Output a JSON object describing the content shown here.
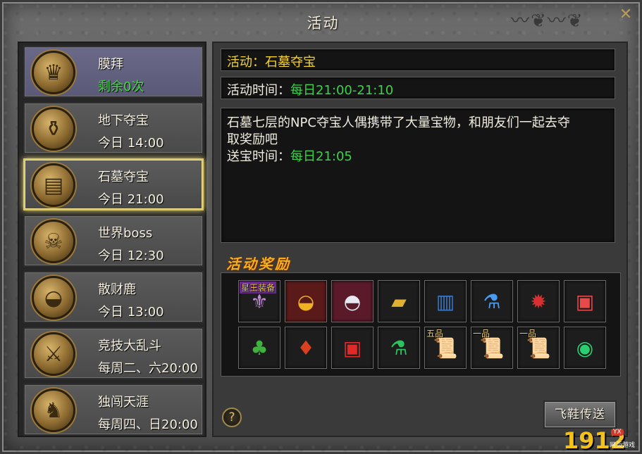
{
  "window": {
    "title": "活动"
  },
  "activities": [
    {
      "name": "膜拜",
      "time": "剩余0次",
      "icon": "statue-icon",
      "glyph": "♛"
    },
    {
      "name": "地下夺宝",
      "time": "今日 14:00",
      "icon": "treasure-pile-icon",
      "glyph": "⚱"
    },
    {
      "name": "石墓夺宝",
      "time": "今日 21:00",
      "icon": "treasure-chest-icon",
      "glyph": "▤"
    },
    {
      "name": "世界boss",
      "time": "今日 12:30",
      "icon": "demon-boss-icon",
      "glyph": "☠"
    },
    {
      "name": "散财鹿",
      "time": "今日 13:00",
      "icon": "gold-ingot-icon",
      "glyph": "◒"
    },
    {
      "name": "竞技大乱斗",
      "time": "每周二、六20:00",
      "icon": "crossed-swords-icon",
      "glyph": "⚔"
    },
    {
      "name": "独闯天涯",
      "time": "每周四、日20:00",
      "icon": "warrior-icon",
      "glyph": "♞"
    }
  ],
  "detail": {
    "activity_label": "活动：石墓夺宝",
    "time_label": "活动时间：",
    "time_value": "每日21:00-21:10",
    "description_line1": "石墓七层的NPC夺宝人偶携带了大量宝物，和朋友们一起去夺",
    "description_line2": "取奖励吧",
    "delivery_label": "送宝时间：",
    "delivery_value": "每日21:05"
  },
  "rewards": {
    "title": "活动奖励",
    "row1": [
      {
        "icon": "star-king-equipment-icon",
        "glyph": "⚜",
        "badge": "星王装备"
      },
      {
        "icon": "gold-ingot-red-icon",
        "glyph": "◒",
        "badge": ""
      },
      {
        "icon": "silver-ingot-icon",
        "glyph": "◓",
        "badge": ""
      },
      {
        "icon": "gold-bar-icon",
        "glyph": "▰",
        "badge": ""
      },
      {
        "icon": "skill-book-icon",
        "glyph": "▥",
        "badge": ""
      },
      {
        "icon": "blue-potion-icon",
        "glyph": "⚗",
        "badge": ""
      },
      {
        "icon": "red-gem-icon",
        "glyph": "✹",
        "badge": ""
      },
      {
        "icon": "gift-box-white-icon",
        "glyph": "▣",
        "badge": ""
      }
    ],
    "row2": [
      {
        "icon": "gourd-bag-icon",
        "glyph": "♣",
        "badge": ""
      },
      {
        "icon": "red-pouch-icon",
        "glyph": "♦",
        "badge": ""
      },
      {
        "icon": "red-gift-box-icon",
        "glyph": "▣",
        "badge": ""
      },
      {
        "icon": "green-potion-icon",
        "glyph": "⚗",
        "badge": ""
      },
      {
        "icon": "scroll-icon",
        "glyph": "📜",
        "badge": "五品"
      },
      {
        "icon": "scroll-icon",
        "glyph": "📜",
        "badge": "一品"
      },
      {
        "icon": "scroll-icon",
        "glyph": "📜",
        "badge": "一品"
      },
      {
        "icon": "green-orb-icon",
        "glyph": "◉",
        "badge": ""
      }
    ]
  },
  "buttons": {
    "help": "?",
    "fly": "飞鞋传送",
    "close": "✕"
  },
  "logo": {
    "text": "1912",
    "sub1": "YX",
    "sub2": "网页游戏"
  },
  "colors": {
    "gold": "#f3d232",
    "green": "#3cd24a",
    "selected_border": "#d9c86a"
  }
}
